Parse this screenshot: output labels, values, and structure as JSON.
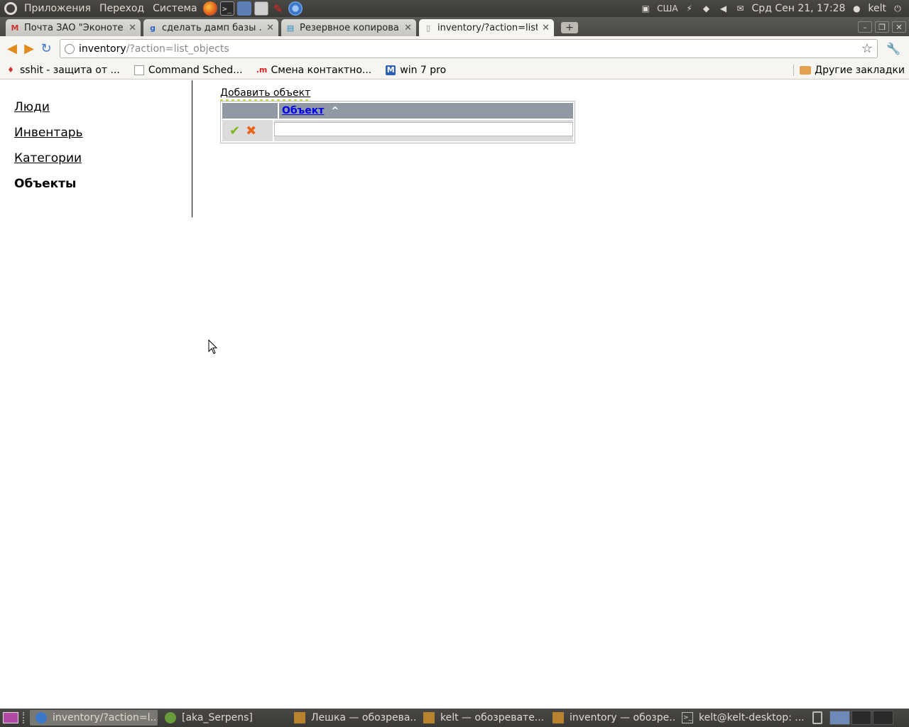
{
  "top_panel": {
    "menus": [
      "Приложения",
      "Переход",
      "Система"
    ],
    "launchers": [
      "firefox-icon",
      "terminal-icon",
      "network-icon",
      "calculator-icon",
      "pen-icon",
      "chromium-icon"
    ],
    "keyboard_layout": "США",
    "datetime": "Срд Сен 21, 17:28",
    "user": "kelt"
  },
  "tabs": [
    {
      "label": "Почта ЗАО \"Эконоте...",
      "favicon": "gmail-icon",
      "active": false
    },
    {
      "label": "сделать дамп базы ...",
      "favicon": "google-icon",
      "active": false
    },
    {
      "label": "Резервное копирова...",
      "favicon": "page-icon",
      "active": false
    },
    {
      "label": "inventory/?action=list...",
      "favicon": "document-icon",
      "active": true
    }
  ],
  "toolbar": {
    "url_host": "inventory",
    "url_path": "/?action=list_objects"
  },
  "bookmarks": [
    {
      "label": "sshit - защита от ...",
      "icon": "sshit-icon"
    },
    {
      "label": "Command Sched...",
      "icon": "document-icon"
    },
    {
      "label": "Смена контактно...",
      "icon": "m-icon"
    },
    {
      "label": "win 7 pro",
      "icon": "m-blue-icon"
    }
  ],
  "other_bookmarks": "Другие закладки",
  "page": {
    "nav": [
      {
        "label": "Люди",
        "current": false
      },
      {
        "label": "Инвентарь",
        "current": false
      },
      {
        "label": "Категории",
        "current": false
      },
      {
        "label": "Объекты",
        "current": true
      }
    ],
    "add_link": "Добавить объект",
    "table": {
      "column_header": "Объект",
      "sort_indicator": "^",
      "new_row_value": ""
    }
  },
  "taskbar": {
    "tasks": [
      {
        "label": "inventory/?action=l...",
        "active": true
      },
      {
        "label": "[aka_Serpens]",
        "active": false
      },
      {
        "label": "Лешка — обозрева...",
        "active": false
      },
      {
        "label": "kelt — обозревате...",
        "active": false
      },
      {
        "label": "inventory — обозре...",
        "active": false
      },
      {
        "label": "kelt@kelt-desktop: ...",
        "active": false
      }
    ]
  }
}
